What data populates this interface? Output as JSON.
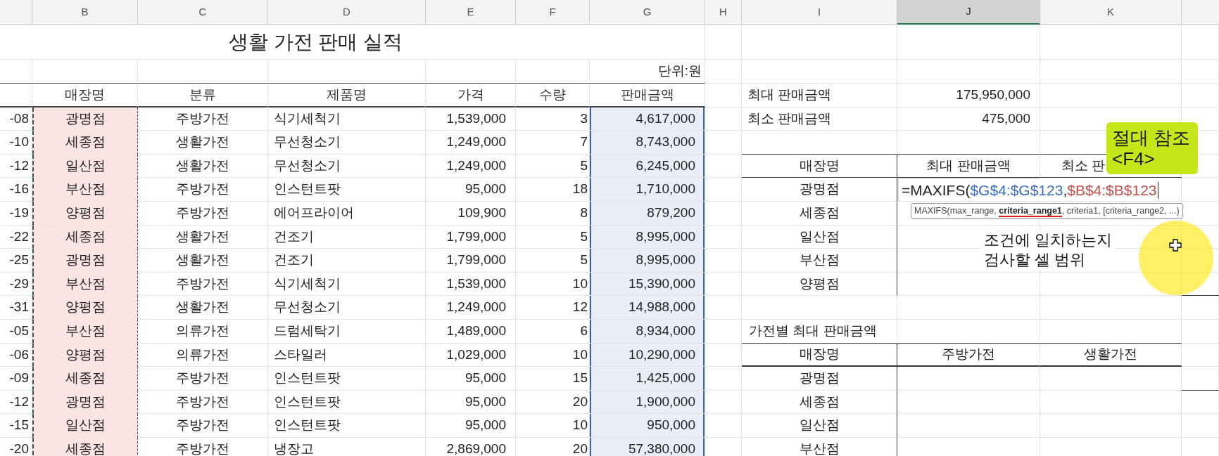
{
  "column_headers": [
    {
      "label": "B",
      "selected": false
    },
    {
      "label": "C",
      "selected": false
    },
    {
      "label": "D",
      "selected": false
    },
    {
      "label": "E",
      "selected": false
    },
    {
      "label": "F",
      "selected": false
    },
    {
      "label": "G",
      "selected": false
    },
    {
      "label": "H",
      "selected": false
    },
    {
      "label": "I",
      "selected": false
    },
    {
      "label": "J",
      "selected": true
    },
    {
      "label": "K",
      "selected": false
    }
  ],
  "title": "생활 가전 판매 실적",
  "unit": "단위:원",
  "sales_table": {
    "columns": [
      {
        "label": "매장명",
        "copied": true,
        "selected": false
      },
      {
        "label": "분류",
        "copied": false,
        "selected": false
      },
      {
        "label": "제품명",
        "copied": false,
        "selected": false
      },
      {
        "label": "가격",
        "copied": false,
        "selected": false
      },
      {
        "label": "수량",
        "copied": false,
        "selected": false
      },
      {
        "label": "판매금액",
        "copied": false,
        "selected": true
      }
    ],
    "rows": [
      {
        "date": "-08",
        "store": "광명점",
        "category": "주방가전",
        "product": "식기세척기",
        "price": "1,539,000",
        "quantity": "3",
        "amount": "4,617,000"
      },
      {
        "date": "-10",
        "store": "세종점",
        "category": "생활가전",
        "product": "무선청소기",
        "price": "1,249,000",
        "quantity": "7",
        "amount": "8,743,000"
      },
      {
        "date": "-12",
        "store": "일산점",
        "category": "생활가전",
        "product": "무선청소기",
        "price": "1,249,000",
        "quantity": "5",
        "amount": "6,245,000"
      },
      {
        "date": "-16",
        "store": "부산점",
        "category": "주방가전",
        "product": "인스턴트팟",
        "price": "95,000",
        "quantity": "18",
        "amount": "1,710,000"
      },
      {
        "date": "-19",
        "store": "양평점",
        "category": "주방가전",
        "product": "에어프라이어",
        "price": "109,900",
        "quantity": "8",
        "amount": "879,200"
      },
      {
        "date": "-22",
        "store": "세종점",
        "category": "생활가전",
        "product": "건조기",
        "price": "1,799,000",
        "quantity": "5",
        "amount": "8,995,000"
      },
      {
        "date": "-25",
        "store": "광명점",
        "category": "생활가전",
        "product": "건조기",
        "price": "1,799,000",
        "quantity": "5",
        "amount": "8,995,000"
      },
      {
        "date": "-29",
        "store": "부산점",
        "category": "주방가전",
        "product": "식기세척기",
        "price": "1,539,000",
        "quantity": "10",
        "amount": "15,390,000"
      },
      {
        "date": "-31",
        "store": "양평점",
        "category": "생활가전",
        "product": "무선청소기",
        "price": "1,249,000",
        "quantity": "12",
        "amount": "14,988,000"
      },
      {
        "date": "-05",
        "store": "부산점",
        "category": "의류가전",
        "product": "드럼세탁기",
        "price": "1,489,000",
        "quantity": "6",
        "amount": "8,934,000"
      },
      {
        "date": "-06",
        "store": "양평점",
        "category": "의류가전",
        "product": "스타일러",
        "price": "1,029,000",
        "quantity": "10",
        "amount": "10,290,000"
      },
      {
        "date": "-09",
        "store": "세종점",
        "category": "주방가전",
        "product": "인스턴트팟",
        "price": "95,000",
        "quantity": "15",
        "amount": "1,425,000"
      },
      {
        "date": "-12",
        "store": "광명점",
        "category": "주방가전",
        "product": "인스턴트팟",
        "price": "95,000",
        "quantity": "20",
        "amount": "1,900,000"
      },
      {
        "date": "-15",
        "store": "일산점",
        "category": "주방가전",
        "product": "인스턴트팟",
        "price": "95,000",
        "quantity": "10",
        "amount": "950,000"
      },
      {
        "date": "-20",
        "store": "세종점",
        "category": "주방가전",
        "product": "냉장고",
        "price": "2,869,000",
        "quantity": "20",
        "amount": "57,380,000"
      }
    ]
  },
  "summary": [
    {
      "label": "최대 판매금액",
      "value": "175,950,000"
    },
    {
      "label": "최소 판매금액",
      "value": "475,000"
    }
  ],
  "store_table": {
    "columns": [
      "매장명",
      "최대 판매금액",
      "최소 판"
    ],
    "rows": [
      {
        "store": "광명점",
        "formula": {
          "parts": [
            {
              "text": "=MAXIFS(",
              "color": "#222222"
            },
            {
              "text": "$G$4:$G$123",
              "color": "#3b6fc4"
            },
            {
              "text": ",",
              "color": "#222222"
            },
            {
              "text": "$B$4:$B$123",
              "color": "#c0504d"
            }
          ],
          "hint": "MAXIFS(max_range, **criteria_range1**, criteria1, [criteria_range2, ...)"
        }
      },
      {
        "store": "세종점"
      },
      {
        "store": "일산점"
      },
      {
        "store": "부산점"
      },
      {
        "store": "양평점"
      }
    ]
  },
  "category_table": {
    "title": "가전별 최대 판매금액",
    "columns": [
      "매장명",
      "주방가전",
      "생활가전"
    ],
    "rows": [
      "광명점",
      "세종점",
      "일산점",
      "부산점"
    ]
  },
  "callout": {
    "lines": [
      "절대 참조",
      "<F4>"
    ]
  },
  "caption": {
    "lines": [
      "조건에 일치하는지",
      "검사할 셀 범위"
    ]
  }
}
